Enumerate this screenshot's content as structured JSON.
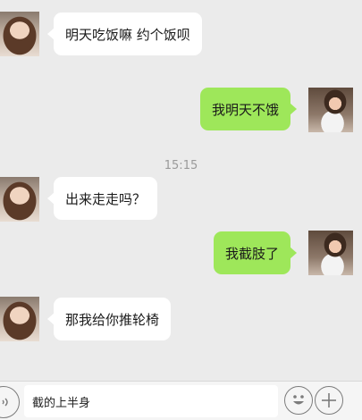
{
  "messages": [
    {
      "side": "left",
      "text": "明天吃饭嘛 约个饭呗"
    },
    {
      "side": "right",
      "text": "我明天不饿"
    },
    {
      "side": "left",
      "text": "出来走走吗？"
    },
    {
      "side": "right",
      "text": "我截肢了"
    },
    {
      "side": "left",
      "text": "那我给你推轮椅"
    }
  ],
  "timestamp": "15:15",
  "input": {
    "value": "截的上半身"
  },
  "icons": {
    "voice": "voice-icon",
    "emoji": "emoji-icon",
    "more": "plus-icon",
    "avatar_left": "girl-avatar",
    "avatar_right": "boy-avatar"
  },
  "colors": {
    "outgoing_bubble": "#9ee75a",
    "incoming_bubble": "#ffffff",
    "background": "#ebebeb"
  }
}
